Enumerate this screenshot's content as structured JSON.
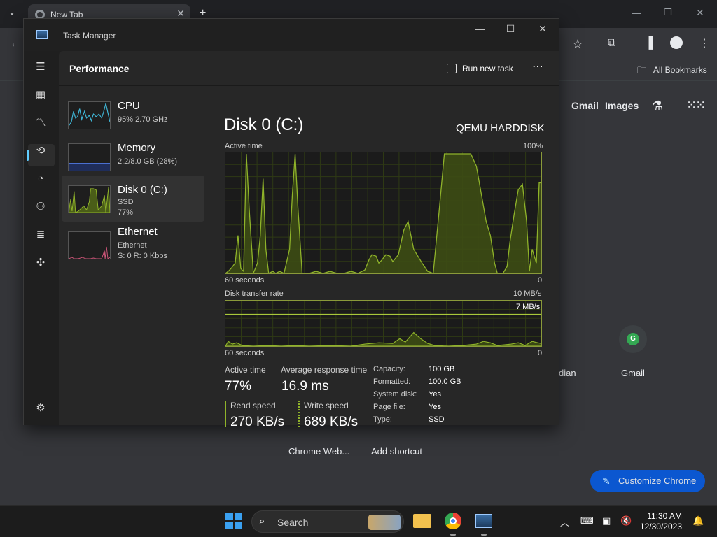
{
  "chrome": {
    "tab_title": "New Tab",
    "bookmarks_label": "All Bookmarks",
    "links": [
      "Gmail",
      "Images"
    ],
    "shortcuts": [
      "dian",
      "Gmail",
      "Chrome Web...",
      "Add shortcut"
    ],
    "gmail_initial": "G",
    "customize_label": "Customize Chrome"
  },
  "taskmanager": {
    "title": "Task Manager",
    "heading": "Performance",
    "run_new_task": "Run new task",
    "more": "⋯",
    "list": [
      {
        "name": "CPU",
        "sub1": "95% 2.70 GHz",
        "sub2": ""
      },
      {
        "name": "Memory",
        "sub1": "2.2/8.0 GB (28%)",
        "sub2": ""
      },
      {
        "name": "Disk 0 (C:)",
        "sub1": "SSD",
        "sub2": "77%"
      },
      {
        "name": "Ethernet",
        "sub1": "Ethernet",
        "sub2": "S: 0 R: 0 Kbps"
      }
    ],
    "detail": {
      "title": "Disk 0 (C:)",
      "model": "QEMU HARDDISK",
      "chart1_label": "Active time",
      "chart1_max": "100%",
      "chart1_x_left": "60 seconds",
      "chart1_x_right": "0",
      "chart2_label": "Disk transfer rate",
      "chart2_max": "10 MB/s",
      "chart2_ref": "7 MB/s",
      "chart2_x_left": "60 seconds",
      "chart2_x_right": "0",
      "active_time_label": "Active time",
      "active_time_value": "77%",
      "avg_resp_label": "Average response time",
      "avg_resp_value": "16.9 ms",
      "read_label": "Read speed",
      "read_value": "270 KB/s",
      "write_label": "Write speed",
      "write_value": "689 KB/s",
      "props": [
        {
          "k": "Capacity:",
          "v": "100 GB"
        },
        {
          "k": "Formatted:",
          "v": "100.0 GB"
        },
        {
          "k": "System disk:",
          "v": "Yes"
        },
        {
          "k": "Page file:",
          "v": "Yes"
        },
        {
          "k": "Type:",
          "v": "SSD"
        }
      ]
    }
  },
  "taskbar": {
    "search_label": "Search",
    "time": "11:30 AM",
    "date": "12/30/2023"
  },
  "colors": {
    "disk_green": "#8fb32a",
    "cpu_blue": "#3fb6d6",
    "memory_blue": "#4a6fd0",
    "ethernet_pink": "#d0567a",
    "accent": "#60cdff"
  }
}
